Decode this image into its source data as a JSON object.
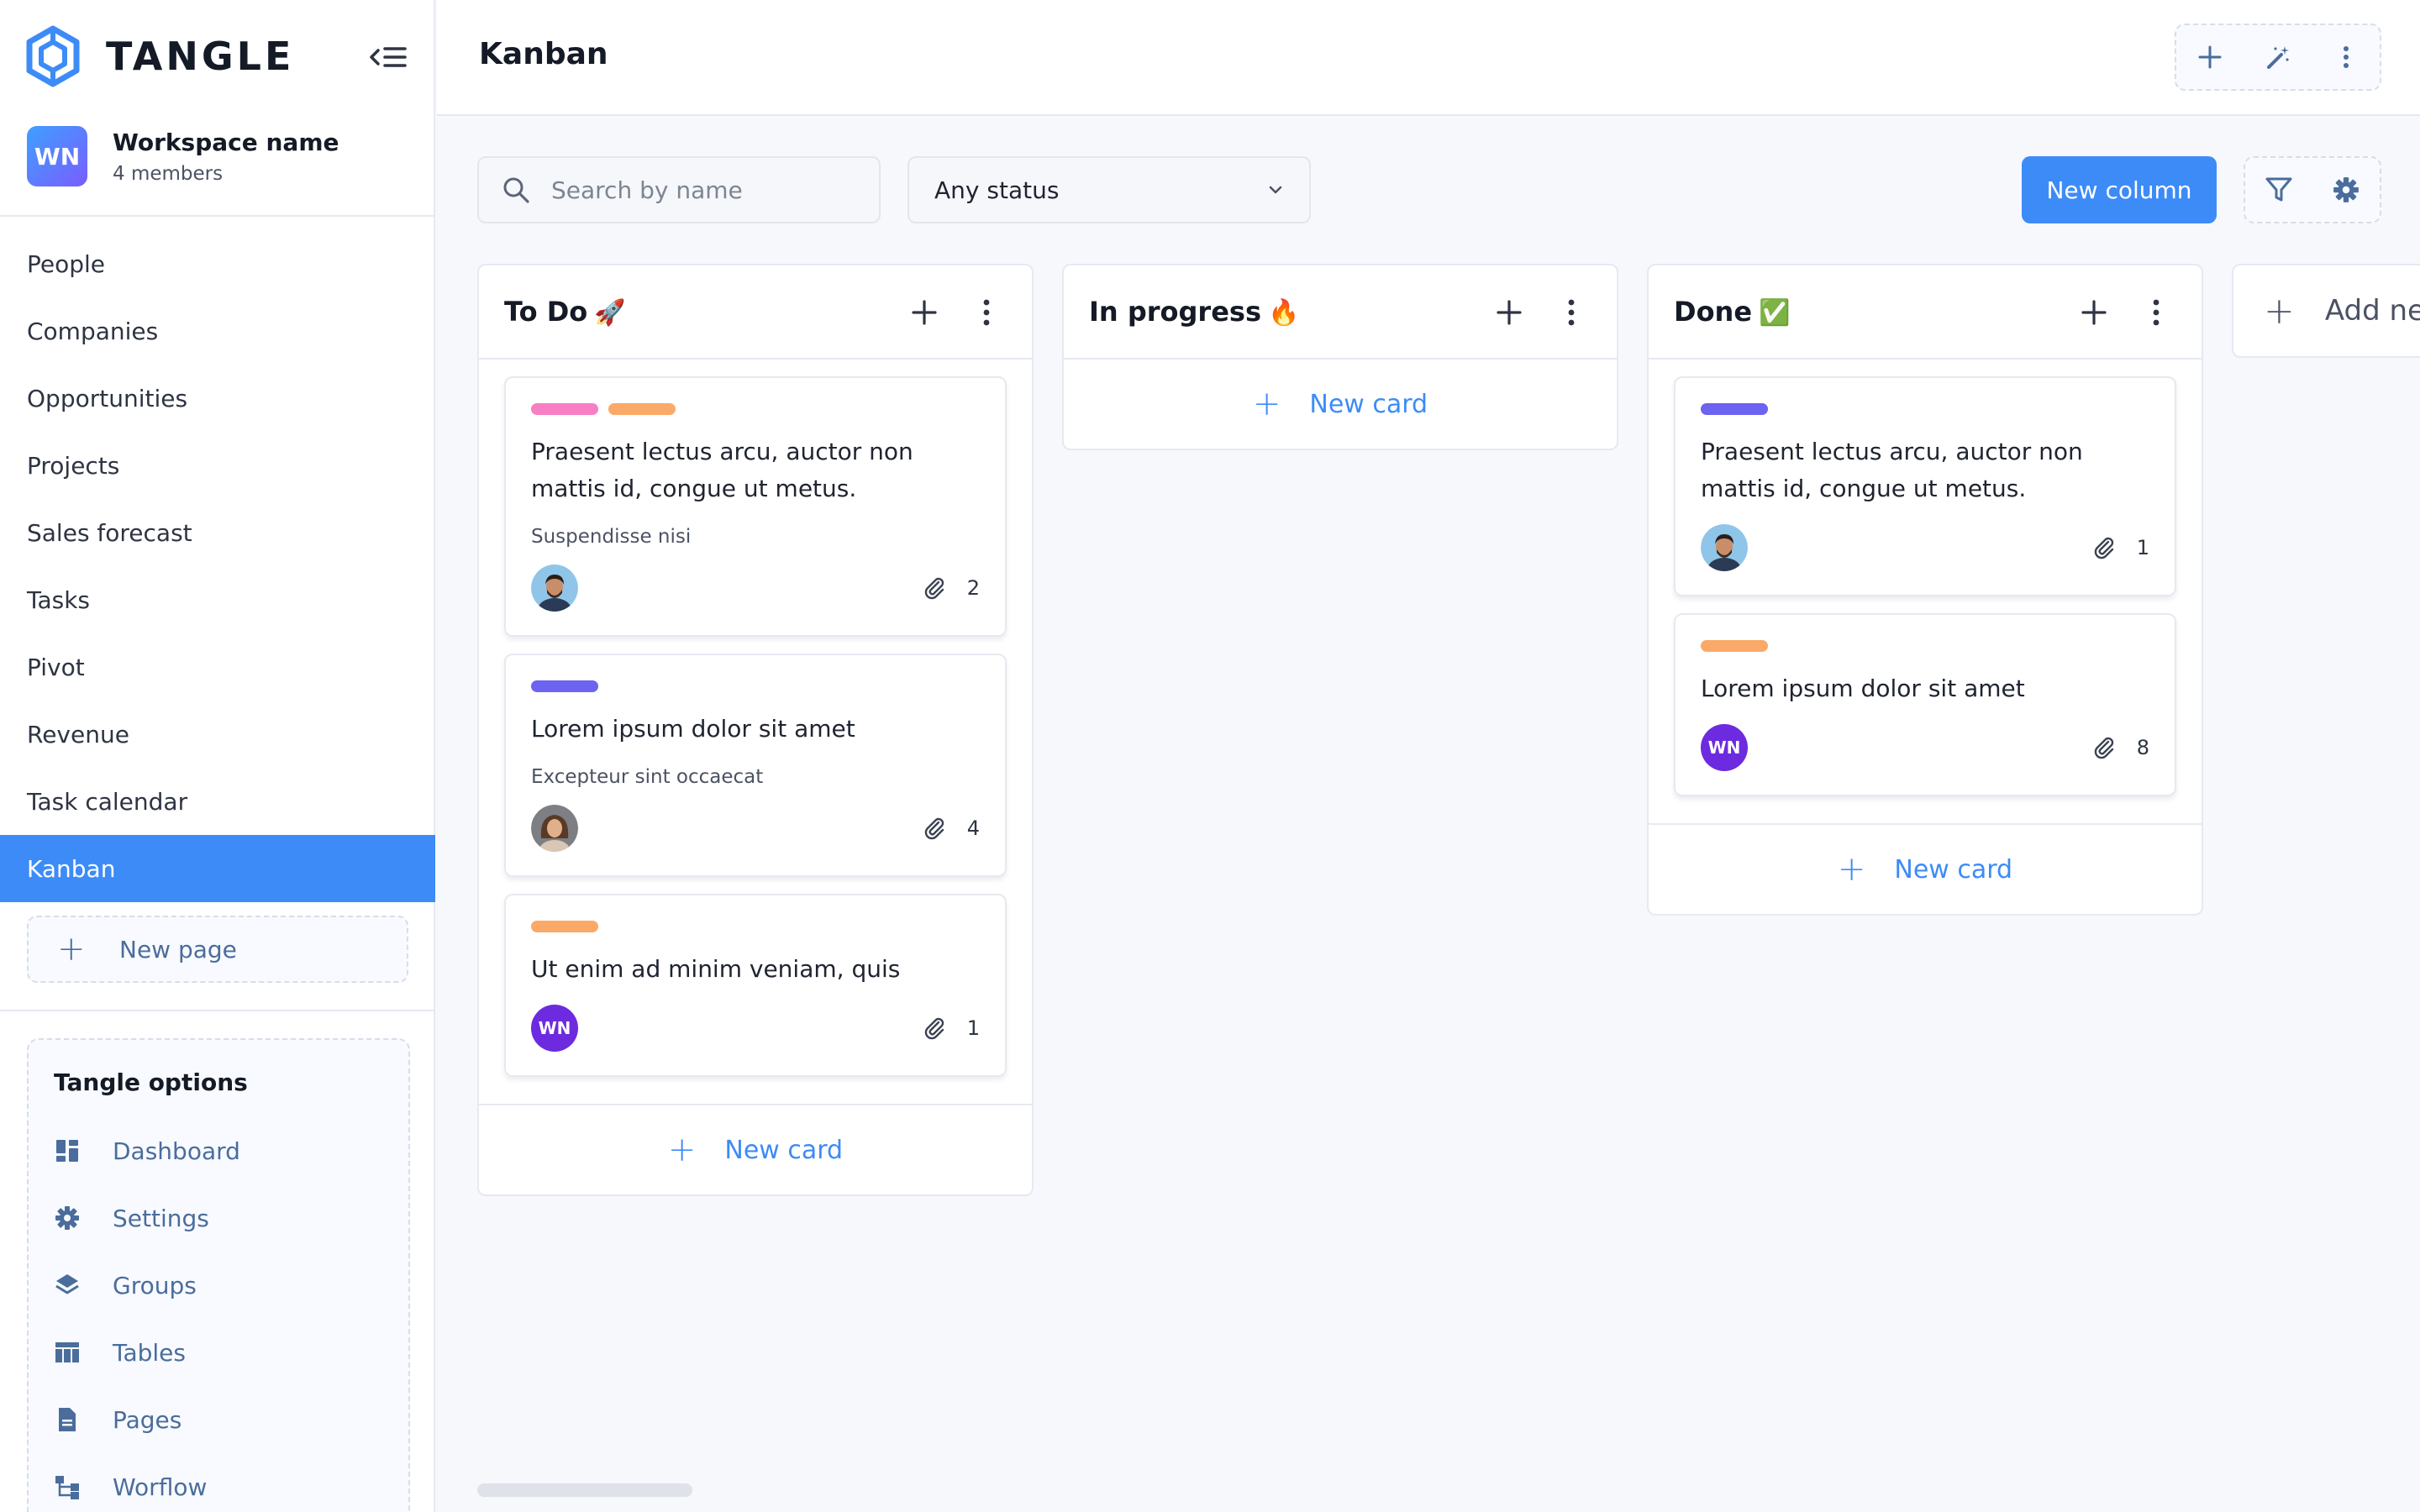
{
  "brand": {
    "name": "TANGLE"
  },
  "workspace": {
    "initials": "WN",
    "name": "Workspace name",
    "members": "4 members"
  },
  "nav": {
    "items": [
      {
        "label": "People"
      },
      {
        "label": "Companies"
      },
      {
        "label": "Opportunities"
      },
      {
        "label": "Projects"
      },
      {
        "label": "Sales forecast"
      },
      {
        "label": "Tasks"
      },
      {
        "label": "Pivot"
      },
      {
        "label": "Revenue"
      },
      {
        "label": "Task calendar"
      },
      {
        "label": "Kanban",
        "active": true
      }
    ],
    "new_page": "New page"
  },
  "options": {
    "title": "Tangle options",
    "items": [
      {
        "label": "Dashboard",
        "icon": "dashboard-icon"
      },
      {
        "label": "Settings",
        "icon": "gear-icon"
      },
      {
        "label": "Groups",
        "icon": "layers-icon"
      },
      {
        "label": "Tables",
        "icon": "table-icon"
      },
      {
        "label": "Pages",
        "icon": "document-icon"
      },
      {
        "label": "Worflow",
        "icon": "workflow-icon"
      }
    ]
  },
  "header": {
    "title": "Kanban"
  },
  "toolbar": {
    "search_placeholder": "Search by name",
    "status_value": "Any status",
    "new_column": "New column"
  },
  "columns": [
    {
      "title": "To Do",
      "emoji": "🚀",
      "new_card": "New card",
      "cards": [
        {
          "tags": [
            "#f77fc4",
            "#fba968"
          ],
          "title": "Praesent lectus arcu, auctor non mattis id, congue ut metus.",
          "subtitle": "Suspendisse nisi",
          "avatar": "man-1",
          "attachments": "2"
        },
        {
          "tags": [
            "#6c63f0"
          ],
          "title": "Lorem ipsum dolor sit amet",
          "subtitle": "Excepteur sint occaecat",
          "avatar": "woman-1",
          "attachments": "4"
        },
        {
          "tags": [
            "#fba968"
          ],
          "title": "Ut enim ad minim veniam, quis",
          "subtitle": "",
          "avatar": "WN",
          "attachments": "1"
        }
      ]
    },
    {
      "title": "In progress",
      "emoji": "🔥",
      "new_card": "New card",
      "cards": []
    },
    {
      "title": "Done",
      "emoji": "✅",
      "new_card": "New card",
      "cards": [
        {
          "tags": [
            "#6c63f0"
          ],
          "title": "Praesent lectus arcu, auctor non mattis id, congue ut metus.",
          "subtitle": "",
          "avatar": "man-2",
          "attachments": "1"
        },
        {
          "tags": [
            "#fba968"
          ],
          "title": "Lorem ipsum dolor sit amet",
          "subtitle": "",
          "avatar": "WN",
          "attachments": "8"
        }
      ]
    }
  ],
  "add_column": "Add ne",
  "colors": {
    "accent": "#3d8bf7",
    "muted_link": "#4a6d9c"
  }
}
